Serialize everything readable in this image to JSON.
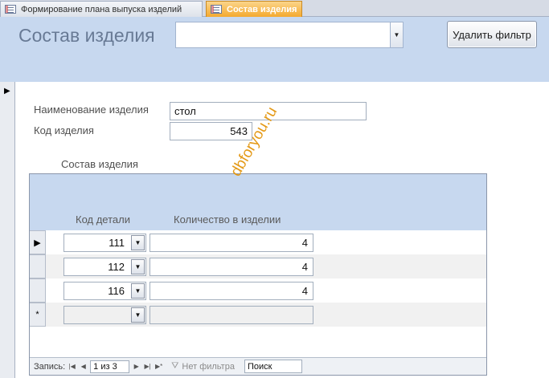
{
  "tabs": [
    {
      "label": "Формирование плана выпуска изделий",
      "active": false
    },
    {
      "label": "Состав изделия",
      "active": true
    }
  ],
  "header": {
    "title": "Состав изделия",
    "combo_value": "",
    "clear_filter_label": "Удалить фильтр"
  },
  "form": {
    "name_label": "Наименование изделия",
    "name_value": "стол",
    "code_label": "Код изделия",
    "code_value": "543"
  },
  "subform": {
    "caption": "Состав изделия",
    "columns": [
      "Код детали",
      "Количество в изделии"
    ],
    "rows": [
      {
        "code": "111",
        "qty": "4"
      },
      {
        "code": "112",
        "qty": "4"
      },
      {
        "code": "116",
        "qty": "4"
      },
      {
        "code": "",
        "qty": ""
      }
    ],
    "new_row_marker": "*"
  },
  "nav": {
    "record_label": "Запись:",
    "position": "1 из 3",
    "filter_label": "Нет фильтра",
    "search_label": "Поиск"
  },
  "watermark": "dbforyou.ru",
  "colors": {
    "header_bg": "#c7d8ef",
    "active_tab": "#f4a92f",
    "title_text": "#687a95",
    "watermark": "#e49a18"
  }
}
